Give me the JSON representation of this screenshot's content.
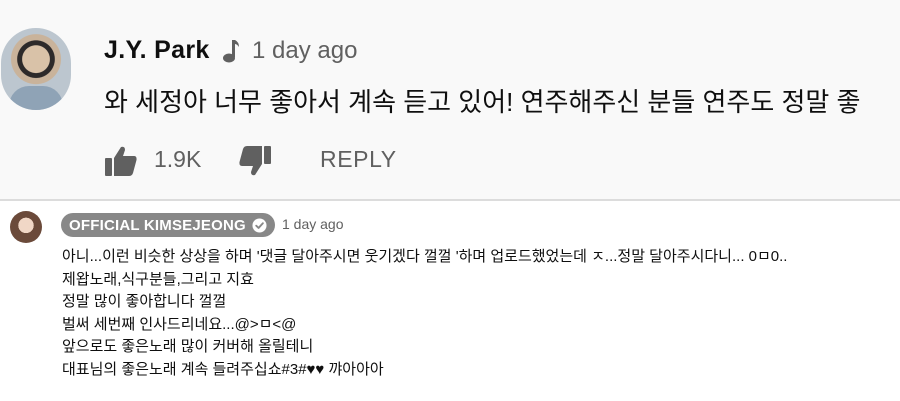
{
  "top_comment": {
    "author": "J.Y. Park",
    "badge_icon": "music-note-icon",
    "timestamp": "1 day ago",
    "text": "와 세정아 너무 좋아서 계속 듣고 있어! 연주해주신 분들 연주도 정말 좋",
    "like_count": "1.9K",
    "reply_label": "REPLY"
  },
  "reply_comment": {
    "author": "OFFICIAL KIMSEJEONG",
    "verified_icon": "verified-check-icon",
    "timestamp": "1 day ago",
    "lines": [
      "아니...이런 비슷한 상상을 하며 '댓글 달아주시면 웃기겠다 껄껄 '하며 업로드했었는데 ㅈ...정말 달아주시다니... 0ㅁ0..",
      "제왑노래,식구분들,그리고 지효",
      "정말 많이 좋아합니다 껄껄",
      "벌써 세번째 인사드리네요...@>ㅁ<@",
      "앞으로도 좋은노래 많이 커버해 올릴테니",
      "대표님의 좋은노래 계속 들려주십쇼#3#♥♥ 꺄아아아"
    ]
  },
  "colors": {
    "top_background": "#f9f9f9",
    "secondary_text": "#606060",
    "author_badge": "#888888"
  }
}
